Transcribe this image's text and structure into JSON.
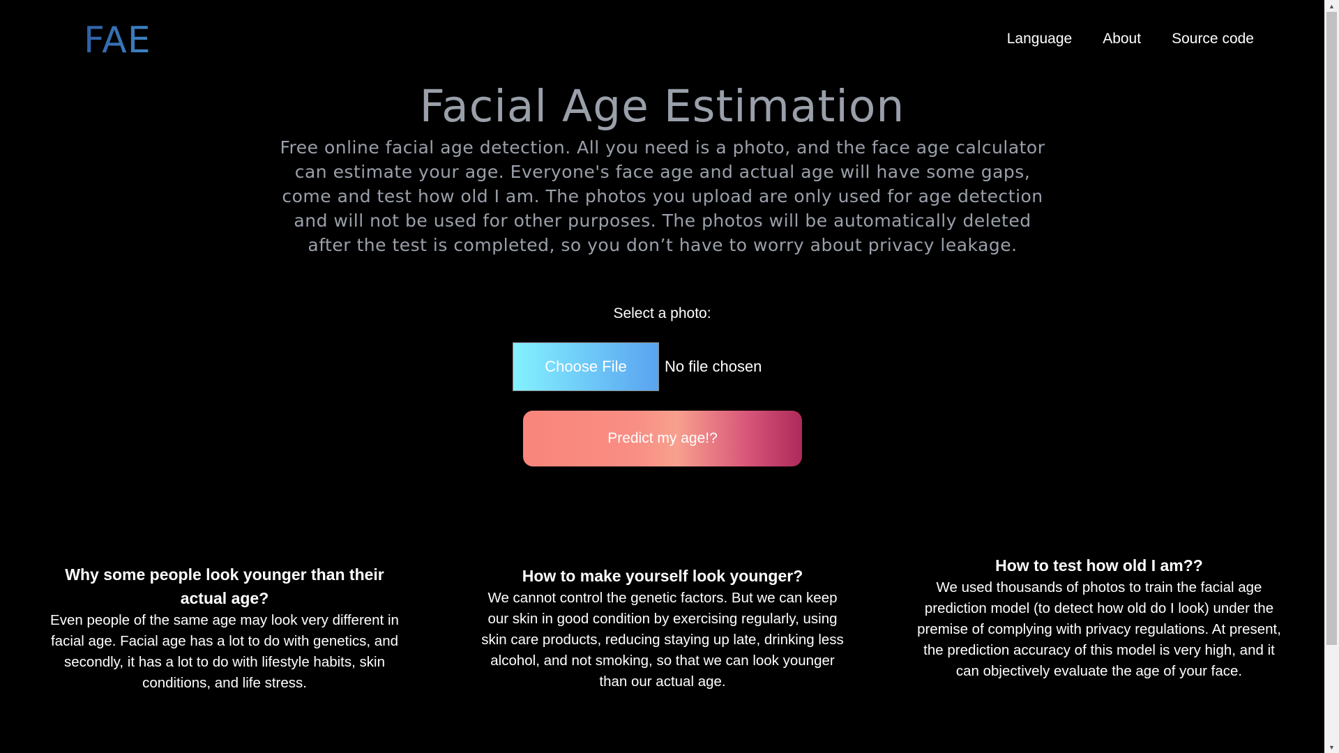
{
  "header": {
    "logo": "FAE",
    "nav": [
      "Language",
      "About",
      "Source code"
    ]
  },
  "hero": {
    "title": "Facial Age Estimation",
    "subtitle": "Free online facial age detection. All you need is a photo, and the face age calculator can estimate your age. Everyone's face age and actual age will have some gaps, come and test how old I am. The photos you upload are only used for age detection and will not be used for other purposes. The photos will be automatically deleted after the test is completed, so you don’t have to worry about privacy leakage."
  },
  "upload": {
    "label": "Select a photo:",
    "choose_button": "Choose File",
    "file_status": "No file chosen",
    "predict_button": "Predict my age!?"
  },
  "info": [
    {
      "heading": "Why some people look younger than their actual age?",
      "text": "Even people of the same age may look very different in facial age. Facial age has a lot to do with genetics, and secondly, it has a lot to do with lifestyle habits, skin conditions, and life stress."
    },
    {
      "heading": "How to make yourself look younger?",
      "text": "We cannot control the genetic factors. But we can keep our skin in good condition by exercising regularly, using skin care products, reducing staying up late, drinking less alcohol, and not smoking, so that we can look younger than our actual age."
    },
    {
      "heading": "How to test how old I am??",
      "text": "We used thousands of photos to train the facial age prediction model (to detect how old do I look) under the premise of complying with privacy regulations. At present, the prediction accuracy of this model is very high, and it can objectively evaluate the age of your face."
    }
  ],
  "icons": {
    "scroll_up": "scroll-up-arrow-icon",
    "scroll_down": "scroll-down-arrow-icon"
  },
  "colors": {
    "background": "#000000",
    "logo_gradient": [
      "#2f5fa6",
      "#3e86c4"
    ],
    "choose_gradient": [
      "#84f1ff",
      "#5aa3f0"
    ],
    "predict_gradient": [
      "#f9857b",
      "#ad2a5a"
    ]
  }
}
